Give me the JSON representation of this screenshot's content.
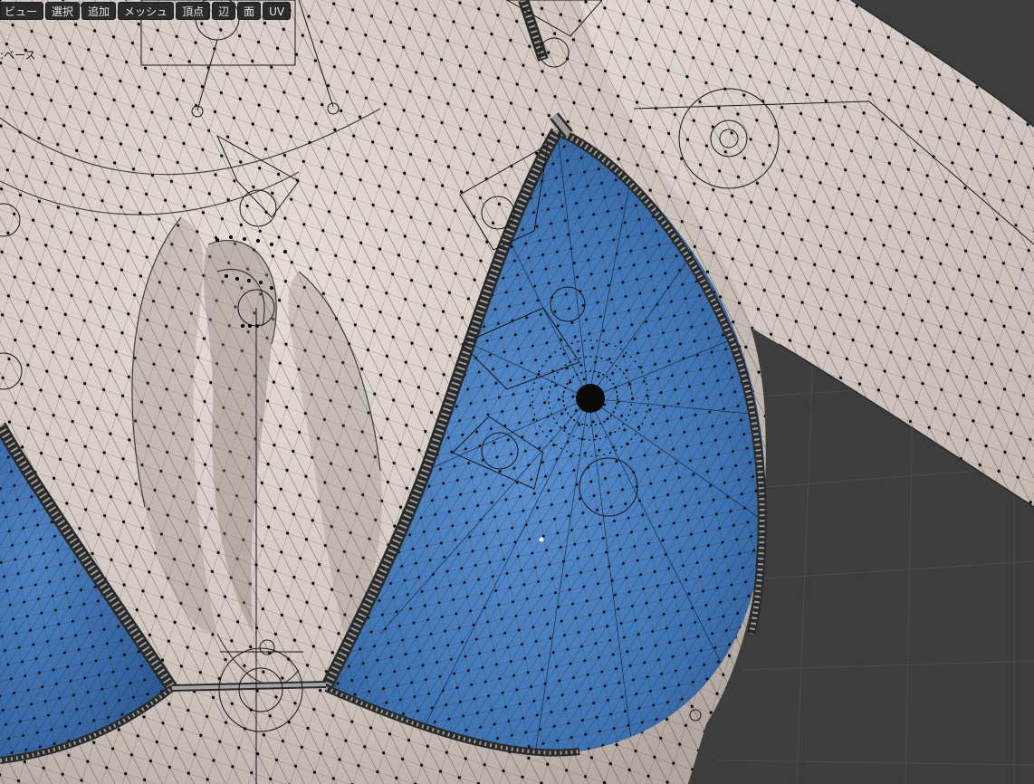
{
  "header": {
    "menu_items": [
      {
        "id": "view",
        "label": "ビュー"
      },
      {
        "id": "select",
        "label": "選択"
      },
      {
        "id": "add",
        "label": "追加"
      },
      {
        "id": "mesh",
        "label": "メッシュ"
      },
      {
        "id": "vertex",
        "label": "頂点"
      },
      {
        "id": "edge",
        "label": "辺"
      },
      {
        "id": "face",
        "label": "面"
      },
      {
        "id": "uv",
        "label": "UV"
      }
    ]
  },
  "viewport": {
    "object_label": ":ベース"
  },
  "colors": {
    "viewport_background": "#3d3d3d",
    "grid_line": "#4a4a4a",
    "skin_fill": "#d9cfca",
    "skin_shadow": "#a79b95",
    "selected_face": "#3f74b3",
    "selected_face_dark": "#2b558c",
    "wire": "#1a1a1a",
    "vertex": "#000000",
    "seam": "#8a8a8a",
    "header_button": "#2b2b2b",
    "header_text": "#e6e6e6"
  }
}
